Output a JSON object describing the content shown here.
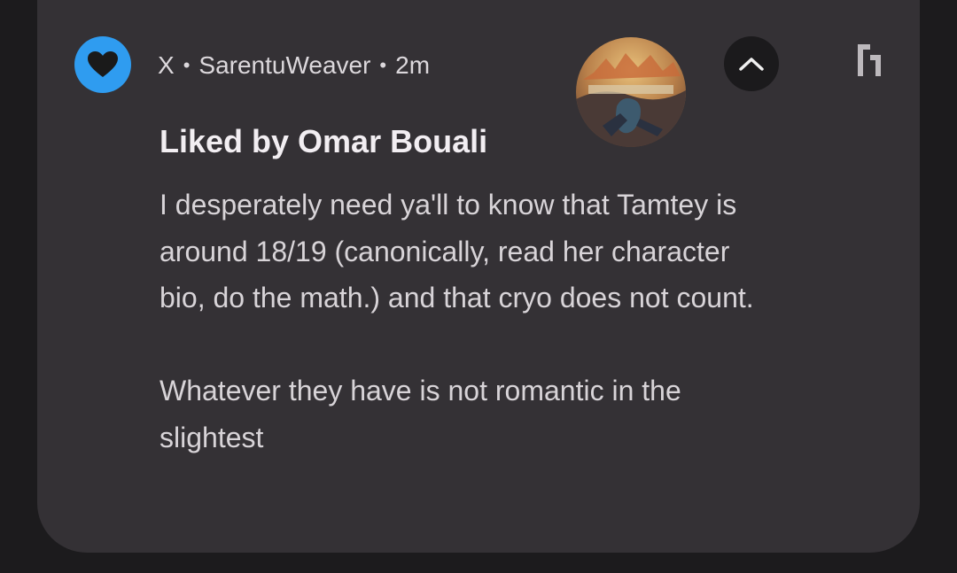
{
  "notification": {
    "app_name": "X",
    "separator": "•",
    "account": "SarentuWeaver",
    "time": "2m",
    "title": "Liked by Omar Bouali",
    "body": [
      "I desperately need ya'll to know that Tamtey is around 18/19 (canonically, read her character bio, do the math.) and that cryo does not count.",
      "Whatever they have is not romantic in the slightest"
    ]
  },
  "icons": {
    "app": "heart-icon",
    "collapse": "chevron-up-icon",
    "bubble": "bubble-icon"
  },
  "colors": {
    "background": "#1c1b1d",
    "card": "#343135",
    "app_icon": "#2f9cf0",
    "title": "#f2eef2",
    "body": "#d8d4d8"
  }
}
